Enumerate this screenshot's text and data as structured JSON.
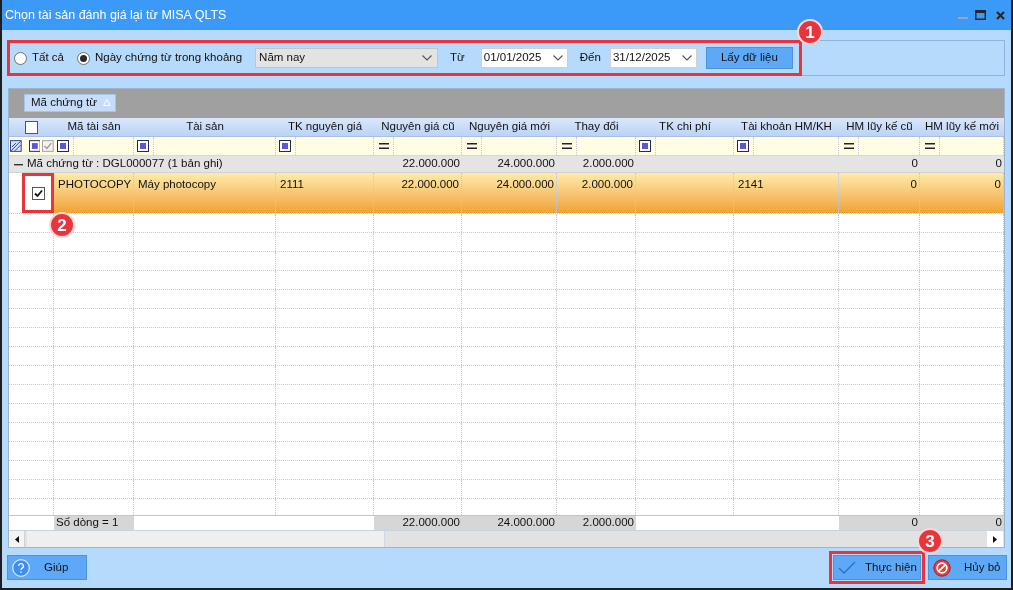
{
  "window": {
    "title": "Chọn tài sản đánh giá lại từ MISA QLTS",
    "controls": [
      {
        "kind": "minimize",
        "disabled": true
      },
      {
        "kind": "maximize",
        "disabled": false
      },
      {
        "kind": "close",
        "disabled": false
      }
    ]
  },
  "filter": {
    "callout": "1",
    "options": [
      {
        "label": "Tất cả",
        "selected": false
      },
      {
        "label": "Ngày chứng từ trong khoảng",
        "selected": true
      }
    ],
    "period": "Năm nay",
    "from_label": "Từ",
    "from_date": "01/01/2025",
    "to_label": "Đến",
    "to_date": "31/12/2025",
    "fetch_button": "Lấy dữ liệu"
  },
  "grid": {
    "group_by": {
      "label": "Mã chứng từ",
      "ascending": true
    },
    "header_checked": false,
    "columns": [
      {
        "label": "Mã tài sản",
        "kind": "text"
      },
      {
        "label": "Tài sản",
        "kind": "text"
      },
      {
        "label": "TK nguyên giá",
        "kind": "text"
      },
      {
        "label": "Nguyên giá cũ",
        "kind": "number"
      },
      {
        "label": "Nguyên giá mới",
        "kind": "number"
      },
      {
        "label": "Thay đổi",
        "kind": "number"
      },
      {
        "label": "TK chi phí",
        "kind": "text"
      },
      {
        "label": "Tài khoản HM/KH",
        "kind": "text"
      },
      {
        "label": "HM lũy kế cũ",
        "kind": "number"
      },
      {
        "label": "HM lũy kế mới",
        "kind": "number"
      }
    ],
    "groups": [
      {
        "label": "Mã chứng từ : DGL000077 (1 bản ghi)",
        "expanded": true,
        "totals": [
          "22.000.000",
          "24.000.000",
          "2.000.000",
          "0",
          "0"
        ],
        "rows": [
          {
            "selected": true,
            "checked": true,
            "callout": "2",
            "cells": [
              "PHOTOCOPY",
              "Máy photocopy",
              "2111",
              "22.000.000",
              "24.000.000",
              "2.000.000",
              null,
              "2141",
              "0",
              "0"
            ]
          }
        ]
      }
    ],
    "footer": {
      "label": "Số dòng = 1",
      "totals": [
        "22.000.000",
        "24.000.000",
        "2.000.000",
        "0",
        "0"
      ]
    }
  },
  "buttons": [
    {
      "kind": "help",
      "label": "Giúp"
    },
    {
      "kind": "confirm",
      "label": "Thực hiện",
      "callout": "3"
    },
    {
      "kind": "cancel",
      "label": "Hủy bỏ"
    }
  ]
}
